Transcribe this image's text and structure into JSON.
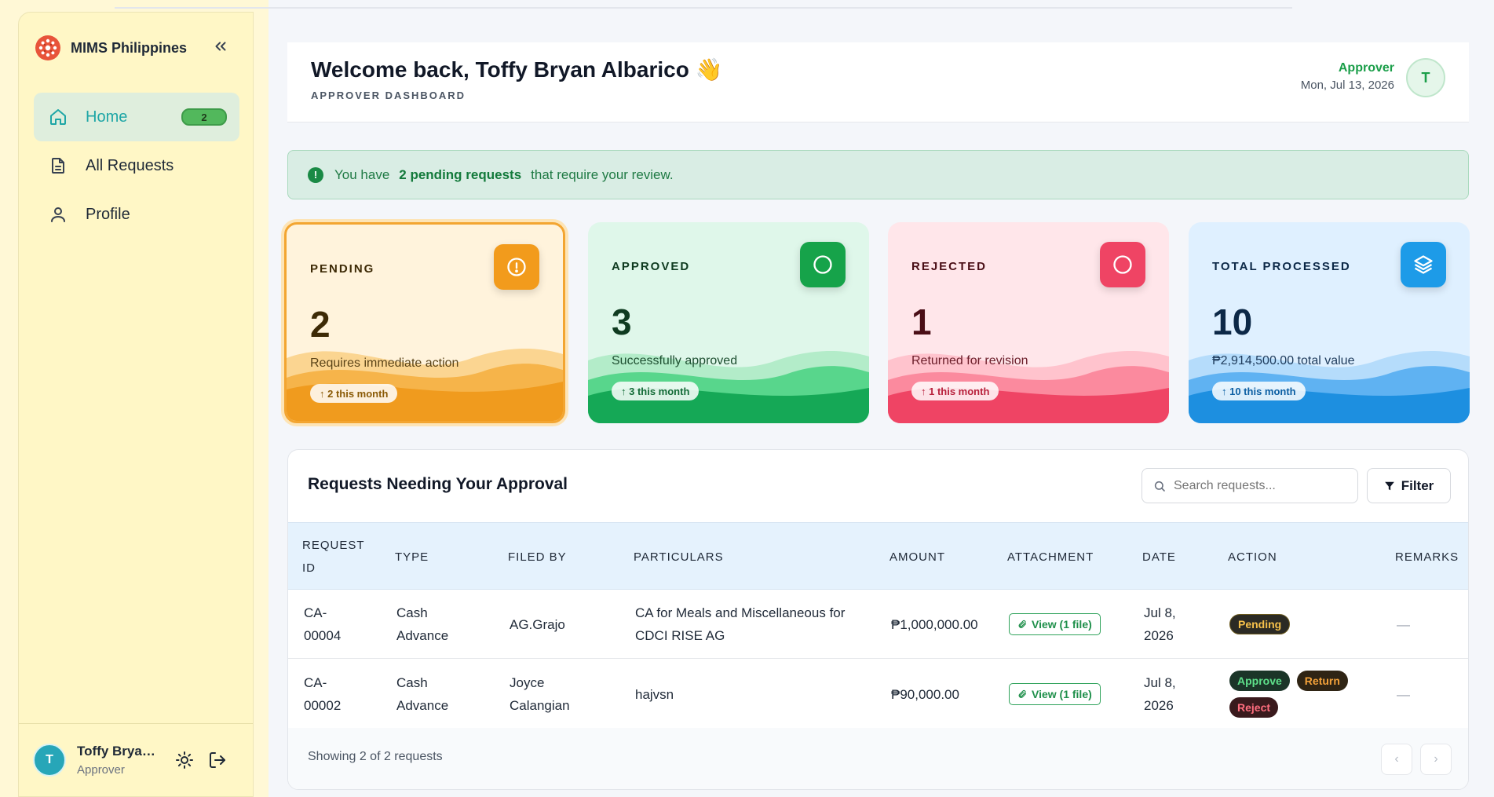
{
  "brand": {
    "name": "MIMS Philippines"
  },
  "sidebar": {
    "items": [
      {
        "label": "Home",
        "icon": "home-icon",
        "badge": "2",
        "active": true
      },
      {
        "label": "All Requests",
        "icon": "document-icon"
      },
      {
        "label": "Profile",
        "icon": "user-icon"
      }
    ],
    "user": {
      "initial": "T",
      "name": "Toffy Bryan Albarico",
      "role": "Approver"
    }
  },
  "header": {
    "welcome": "Welcome back, Toffy Bryan Albarico 👋",
    "subtitle": "APPROVER DASHBOARD",
    "role": "Approver",
    "date": "Mon, Jul 13, 2026",
    "avatar_initial": "T"
  },
  "alert": {
    "prefix": "You have",
    "highlight": "2 pending requests",
    "suffix": "that require your review.",
    "icon_char": "!"
  },
  "stats": {
    "pending": {
      "label": "PENDING",
      "value": "2",
      "desc": "Requires immediate action",
      "chip": "↑ 2 this month"
    },
    "approved": {
      "label": "APPROVED",
      "value": "3",
      "desc": "Successfully approved",
      "chip": "↑ 3 this month"
    },
    "rejected": {
      "label": "REJECTED",
      "value": "1",
      "desc": "Returned for revision",
      "chip": "↑ 1 this month"
    },
    "total": {
      "label": "TOTAL PROCESSED",
      "value": "10",
      "desc": "₱2,914,500.00 total value",
      "chip": "↑ 10 this month"
    }
  },
  "table": {
    "title": "Requests Needing Your Approval",
    "search_placeholder": "Search requests...",
    "filter_label": "Filter",
    "columns": {
      "request_id": "REQUEST ID",
      "type": "TYPE",
      "filed_by": "FILED BY",
      "particulars": "PARTICULARS",
      "amount": "AMOUNT",
      "attachment": "ATTACHMENT",
      "date": "DATE",
      "action": "ACTION",
      "remarks": "REMARKS"
    },
    "rows": [
      {
        "request_id": "CA-00004",
        "type": "Cash Advance",
        "filed_by": "AG.Grajo",
        "particulars": "CA for Meals and Miscellaneous for CDCI RISE AG",
        "amount": "₱1,000,000.00",
        "attachment": "View (1 file)",
        "date": "Jul 8, 2026",
        "status": "Pending",
        "remarks": "—"
      },
      {
        "request_id": "CA-00002",
        "type": "Cash Advance",
        "filed_by": "Joyce Calangian",
        "particulars": "hajvsn",
        "amount": "₱90,000.00",
        "attachment": "View (1 file)",
        "date": "Jul 8, 2026",
        "actions": {
          "approve": "Approve",
          "return": "Return",
          "reject": "Reject"
        },
        "remarks": "—"
      }
    ],
    "showing": "Showing 2 of 2 requests",
    "prev": "‹",
    "next": "›"
  },
  "colors": {
    "accent_teal": "#1ea6a6",
    "green": "#1a9e49",
    "pending": "#f3a531",
    "approved": "#16a34a",
    "rejected": "#ef4464",
    "total": "#1d8fe0"
  }
}
